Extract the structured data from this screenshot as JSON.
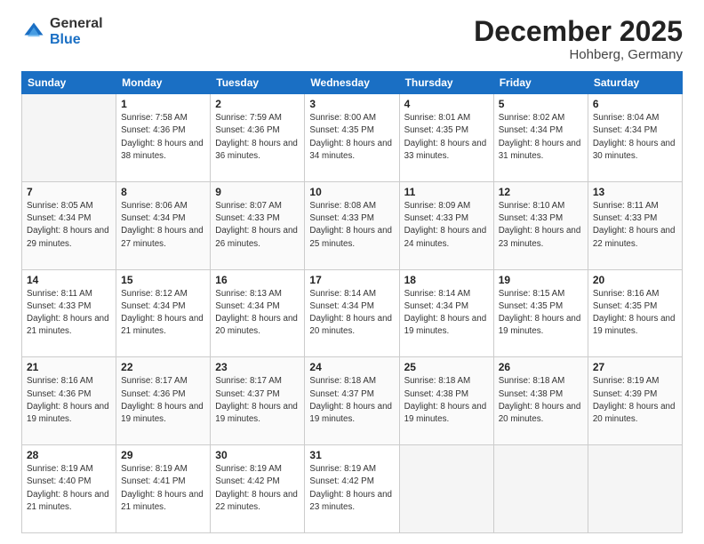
{
  "header": {
    "logo_general": "General",
    "logo_blue": "Blue",
    "month_title": "December 2025",
    "location": "Hohberg, Germany"
  },
  "days": [
    "Sunday",
    "Monday",
    "Tuesday",
    "Wednesday",
    "Thursday",
    "Friday",
    "Saturday"
  ],
  "weeks": [
    [
      {
        "num": "",
        "sunrise": "",
        "sunset": "",
        "daylight": ""
      },
      {
        "num": "1",
        "sunrise": "Sunrise: 7:58 AM",
        "sunset": "Sunset: 4:36 PM",
        "daylight": "Daylight: 8 hours and 38 minutes."
      },
      {
        "num": "2",
        "sunrise": "Sunrise: 7:59 AM",
        "sunset": "Sunset: 4:36 PM",
        "daylight": "Daylight: 8 hours and 36 minutes."
      },
      {
        "num": "3",
        "sunrise": "Sunrise: 8:00 AM",
        "sunset": "Sunset: 4:35 PM",
        "daylight": "Daylight: 8 hours and 34 minutes."
      },
      {
        "num": "4",
        "sunrise": "Sunrise: 8:01 AM",
        "sunset": "Sunset: 4:35 PM",
        "daylight": "Daylight: 8 hours and 33 minutes."
      },
      {
        "num": "5",
        "sunrise": "Sunrise: 8:02 AM",
        "sunset": "Sunset: 4:34 PM",
        "daylight": "Daylight: 8 hours and 31 minutes."
      },
      {
        "num": "6",
        "sunrise": "Sunrise: 8:04 AM",
        "sunset": "Sunset: 4:34 PM",
        "daylight": "Daylight: 8 hours and 30 minutes."
      }
    ],
    [
      {
        "num": "7",
        "sunrise": "Sunrise: 8:05 AM",
        "sunset": "Sunset: 4:34 PM",
        "daylight": "Daylight: 8 hours and 29 minutes."
      },
      {
        "num": "8",
        "sunrise": "Sunrise: 8:06 AM",
        "sunset": "Sunset: 4:34 PM",
        "daylight": "Daylight: 8 hours and 27 minutes."
      },
      {
        "num": "9",
        "sunrise": "Sunrise: 8:07 AM",
        "sunset": "Sunset: 4:33 PM",
        "daylight": "Daylight: 8 hours and 26 minutes."
      },
      {
        "num": "10",
        "sunrise": "Sunrise: 8:08 AM",
        "sunset": "Sunset: 4:33 PM",
        "daylight": "Daylight: 8 hours and 25 minutes."
      },
      {
        "num": "11",
        "sunrise": "Sunrise: 8:09 AM",
        "sunset": "Sunset: 4:33 PM",
        "daylight": "Daylight: 8 hours and 24 minutes."
      },
      {
        "num": "12",
        "sunrise": "Sunrise: 8:10 AM",
        "sunset": "Sunset: 4:33 PM",
        "daylight": "Daylight: 8 hours and 23 minutes."
      },
      {
        "num": "13",
        "sunrise": "Sunrise: 8:11 AM",
        "sunset": "Sunset: 4:33 PM",
        "daylight": "Daylight: 8 hours and 22 minutes."
      }
    ],
    [
      {
        "num": "14",
        "sunrise": "Sunrise: 8:11 AM",
        "sunset": "Sunset: 4:33 PM",
        "daylight": "Daylight: 8 hours and 21 minutes."
      },
      {
        "num": "15",
        "sunrise": "Sunrise: 8:12 AM",
        "sunset": "Sunset: 4:34 PM",
        "daylight": "Daylight: 8 hours and 21 minutes."
      },
      {
        "num": "16",
        "sunrise": "Sunrise: 8:13 AM",
        "sunset": "Sunset: 4:34 PM",
        "daylight": "Daylight: 8 hours and 20 minutes."
      },
      {
        "num": "17",
        "sunrise": "Sunrise: 8:14 AM",
        "sunset": "Sunset: 4:34 PM",
        "daylight": "Daylight: 8 hours and 20 minutes."
      },
      {
        "num": "18",
        "sunrise": "Sunrise: 8:14 AM",
        "sunset": "Sunset: 4:34 PM",
        "daylight": "Daylight: 8 hours and 19 minutes."
      },
      {
        "num": "19",
        "sunrise": "Sunrise: 8:15 AM",
        "sunset": "Sunset: 4:35 PM",
        "daylight": "Daylight: 8 hours and 19 minutes."
      },
      {
        "num": "20",
        "sunrise": "Sunrise: 8:16 AM",
        "sunset": "Sunset: 4:35 PM",
        "daylight": "Daylight: 8 hours and 19 minutes."
      }
    ],
    [
      {
        "num": "21",
        "sunrise": "Sunrise: 8:16 AM",
        "sunset": "Sunset: 4:36 PM",
        "daylight": "Daylight: 8 hours and 19 minutes."
      },
      {
        "num": "22",
        "sunrise": "Sunrise: 8:17 AM",
        "sunset": "Sunset: 4:36 PM",
        "daylight": "Daylight: 8 hours and 19 minutes."
      },
      {
        "num": "23",
        "sunrise": "Sunrise: 8:17 AM",
        "sunset": "Sunset: 4:37 PM",
        "daylight": "Daylight: 8 hours and 19 minutes."
      },
      {
        "num": "24",
        "sunrise": "Sunrise: 8:18 AM",
        "sunset": "Sunset: 4:37 PM",
        "daylight": "Daylight: 8 hours and 19 minutes."
      },
      {
        "num": "25",
        "sunrise": "Sunrise: 8:18 AM",
        "sunset": "Sunset: 4:38 PM",
        "daylight": "Daylight: 8 hours and 19 minutes."
      },
      {
        "num": "26",
        "sunrise": "Sunrise: 8:18 AM",
        "sunset": "Sunset: 4:38 PM",
        "daylight": "Daylight: 8 hours and 20 minutes."
      },
      {
        "num": "27",
        "sunrise": "Sunrise: 8:19 AM",
        "sunset": "Sunset: 4:39 PM",
        "daylight": "Daylight: 8 hours and 20 minutes."
      }
    ],
    [
      {
        "num": "28",
        "sunrise": "Sunrise: 8:19 AM",
        "sunset": "Sunset: 4:40 PM",
        "daylight": "Daylight: 8 hours and 21 minutes."
      },
      {
        "num": "29",
        "sunrise": "Sunrise: 8:19 AM",
        "sunset": "Sunset: 4:41 PM",
        "daylight": "Daylight: 8 hours and 21 minutes."
      },
      {
        "num": "30",
        "sunrise": "Sunrise: 8:19 AM",
        "sunset": "Sunset: 4:42 PM",
        "daylight": "Daylight: 8 hours and 22 minutes."
      },
      {
        "num": "31",
        "sunrise": "Sunrise: 8:19 AM",
        "sunset": "Sunset: 4:42 PM",
        "daylight": "Daylight: 8 hours and 23 minutes."
      },
      {
        "num": "",
        "sunrise": "",
        "sunset": "",
        "daylight": ""
      },
      {
        "num": "",
        "sunrise": "",
        "sunset": "",
        "daylight": ""
      },
      {
        "num": "",
        "sunrise": "",
        "sunset": "",
        "daylight": ""
      }
    ]
  ]
}
